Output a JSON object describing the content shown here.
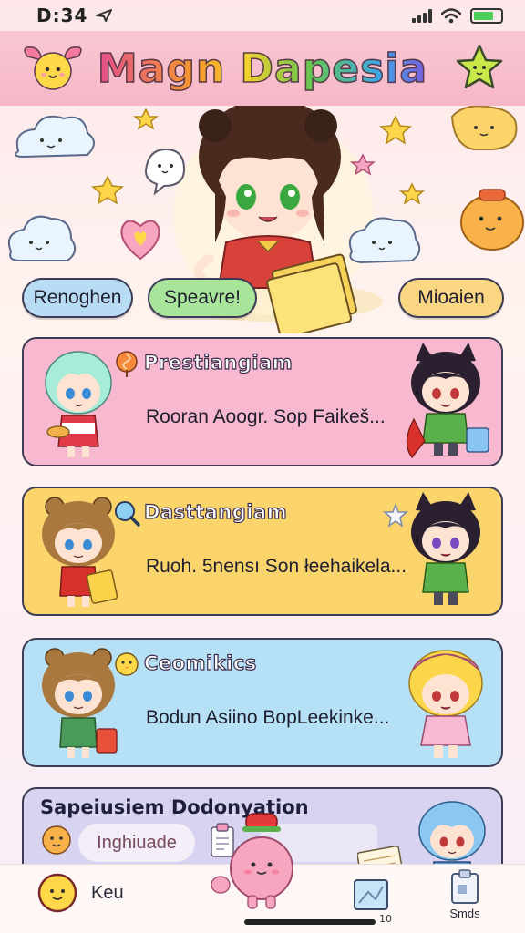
{
  "status_bar": {
    "time": "D:34"
  },
  "header": {
    "title": "Magn Dapesia"
  },
  "pills": [
    {
      "label": "Renoghen",
      "color": "#b9dcf5"
    },
    {
      "label": "Speavre!",
      "color": "#a8e59a"
    },
    {
      "label": "Mioaien",
      "color": "#fbd784"
    }
  ],
  "cards": [
    {
      "title": "Prestiangiam",
      "description": "Rooran Aoogr. Sop Faikeš...",
      "color": "#f8b8cf",
      "icon": "lollipop-icon"
    },
    {
      "title": "Dasttangiam",
      "description": "Ruoh. 5nensı Son łeehaikela...",
      "color": "#fbd56c",
      "icon": "magnifier-icon"
    },
    {
      "title": "Ceomikics",
      "description": "Bodun Asiino BopLeekinke...",
      "color": "#b6e0f6",
      "icon": "chick-icon"
    }
  ],
  "section": {
    "title": "Sapeiusiem Dodonyation",
    "input_text": "Inghiuade"
  },
  "bottom_nav": {
    "left_label": "Keu",
    "right_label": "Smds",
    "small_num": "10"
  },
  "colors": {
    "accent": "#f6b7c7",
    "outline": "#3d3d55"
  }
}
